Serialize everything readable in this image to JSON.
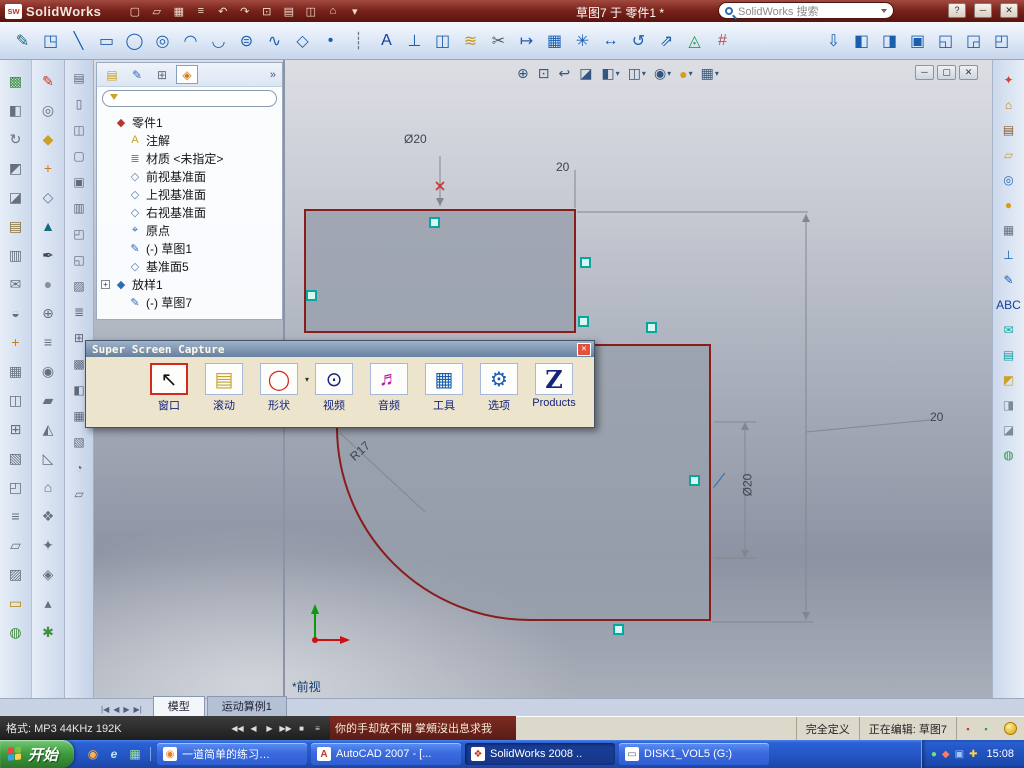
{
  "titlebar": {
    "logo_badge": "sw",
    "logo_text": "SolidWorks",
    "menu_icons": [
      {
        "glyph": "▢",
        "name": "new-document-icon"
      },
      {
        "glyph": "▱",
        "name": "open-icon"
      },
      {
        "glyph": "▦",
        "name": "save-icon"
      },
      {
        "glyph": "≡",
        "name": "print-icon"
      },
      {
        "glyph": "↶",
        "name": "undo-icon"
      },
      {
        "glyph": "↷",
        "name": "redo-icon"
      },
      {
        "glyph": "⊡",
        "name": "select-icon"
      },
      {
        "glyph": "▤",
        "name": "rebuild-icon"
      },
      {
        "glyph": "◫",
        "name": "options-icon"
      },
      {
        "glyph": "⌂",
        "name": "appearance-icon"
      },
      {
        "glyph": "▾",
        "name": "menu-expand-icon"
      }
    ],
    "doc_title": "草图7 于 零件1 *",
    "search": {
      "placeholder": "SolidWorks 搜索"
    },
    "window_buttons": [
      {
        "glyph": "?",
        "name": "help-button"
      },
      {
        "glyph": "─",
        "name": "minimize-button"
      },
      {
        "glyph": "✕",
        "name": "close-button"
      }
    ]
  },
  "main_toolbar": {
    "icons": [
      {
        "glyph": "✎",
        "color": "#17697d",
        "name": "sketch-tool-icon"
      },
      {
        "glyph": "◳",
        "color": "#1a5fae",
        "name": "3d-sketch-icon"
      },
      {
        "glyph": "╲",
        "color": "#1a5fae",
        "name": "line-tool-icon"
      },
      {
        "glyph": "▭",
        "color": "#1a5fae",
        "name": "rectangle-tool-icon"
      },
      {
        "glyph": "◯",
        "color": "#1a5fae",
        "name": "circle-tool-icon"
      },
      {
        "glyph": "◎",
        "color": "#1a5fae",
        "name": "perimeter-circle-icon"
      },
      {
        "glyph": "◠",
        "color": "#1a5fae",
        "name": "centerpoint-arc-icon"
      },
      {
        "glyph": "◡",
        "color": "#1a5fae",
        "name": "tangent-arc-icon"
      },
      {
        "glyph": "⊜",
        "color": "#1a5fae",
        "name": "ellipse-tool-icon"
      },
      {
        "glyph": "∿",
        "color": "#1a5fae",
        "name": "spline-tool-icon"
      },
      {
        "glyph": "◇",
        "color": "#1a5fae",
        "name": "polygon-tool-icon"
      },
      {
        "glyph": "•",
        "color": "#1a5fae",
        "name": "point-tool-icon"
      },
      {
        "glyph": "┊",
        "color": "#667788",
        "name": "centerline-tool-icon"
      },
      {
        "glyph": "A",
        "color": "#123f9e",
        "name": "text-tool-icon"
      },
      {
        "glyph": "⊥",
        "color": "#1a5fae",
        "name": "convert-entities-icon"
      },
      {
        "glyph": "◫",
        "color": "#1a5fae",
        "name": "mirror-entities-icon"
      },
      {
        "glyph": "≋",
        "color": "#c99312",
        "name": "offset-entities-icon"
      },
      {
        "glyph": "✂",
        "color": "#555555",
        "name": "trim-entities-icon"
      },
      {
        "glyph": "↦",
        "color": "#1a5fae",
        "name": "extend-entities-icon"
      },
      {
        "glyph": "▦",
        "color": "#1a5fae",
        "name": "linear-pattern-icon"
      },
      {
        "glyph": "✳",
        "color": "#1a5fae",
        "name": "circular-pattern-icon"
      },
      {
        "glyph": "↔",
        "color": "#1a5fae",
        "name": "move-entities-icon"
      },
      {
        "glyph": "↺",
        "color": "#1a5fae",
        "name": "rotate-entities-icon"
      },
      {
        "glyph": "⇗",
        "color": "#1a5fae",
        "name": "scale-entities-icon"
      },
      {
        "glyph": "◬",
        "color": "#2a9d4a",
        "name": "add-relation-icon"
      },
      {
        "glyph": "#",
        "color": "#bf4a4a",
        "name": "grid-icon"
      }
    ],
    "right_icons": [
      {
        "glyph": "⇩",
        "color": "#1a5fae",
        "name": "insert-icon"
      },
      {
        "glyph": "◧",
        "color": "#1a5fae",
        "name": "window-left-icon"
      },
      {
        "glyph": "◨",
        "color": "#1a5fae",
        "name": "window-right-icon"
      },
      {
        "glyph": "▣",
        "color": "#1a5fae",
        "name": "new-window-icon"
      },
      {
        "glyph": "◱",
        "color": "#1a5fae",
        "name": "tile-windows-icon"
      },
      {
        "glyph": "◲",
        "color": "#1a5fae",
        "name": "cascade-windows-icon"
      },
      {
        "glyph": "◰",
        "color": "#1a5fae",
        "name": "arrange-windows-icon"
      }
    ]
  },
  "left_toolbar_a": {
    "icons": [
      {
        "glyph": "▩",
        "color": "#3f8f3f"
      },
      {
        "glyph": "◧",
        "color": "#66707e"
      },
      {
        "glyph": "↻",
        "color": "#66707e"
      },
      {
        "glyph": "◩",
        "color": "#66707e"
      },
      {
        "glyph": "◪",
        "color": "#66707e"
      },
      {
        "glyph": "▤",
        "color": "#8a7340"
      },
      {
        "glyph": "▥",
        "color": "#66707e"
      },
      {
        "glyph": "✉",
        "color": "#66707e"
      },
      {
        "glyph": "◒",
        "color": "#66707e"
      },
      {
        "glyph": "+",
        "color": "#d07a1a"
      },
      {
        "glyph": "▦",
        "color": "#66707e"
      },
      {
        "glyph": "◫",
        "color": "#66707e"
      },
      {
        "glyph": "⊞",
        "color": "#66707e"
      },
      {
        "glyph": "▧",
        "color": "#66707e"
      },
      {
        "glyph": "◰",
        "color": "#66707e"
      },
      {
        "glyph": "≡",
        "color": "#66707e"
      },
      {
        "glyph": "▱",
        "color": "#66707e"
      },
      {
        "glyph": "▨",
        "color": "#66707e"
      },
      {
        "glyph": "▭",
        "color": "#b8860b"
      },
      {
        "glyph": "◍",
        "color": "#3f8f3f"
      }
    ]
  },
  "left_toolbar_b": {
    "icons": [
      {
        "glyph": "✎",
        "color": "#c0392b"
      },
      {
        "glyph": "◎",
        "color": "#66707e"
      },
      {
        "glyph": "◆",
        "color": "#c9a227"
      },
      {
        "glyph": "+",
        "color": "#d07a1a"
      },
      {
        "glyph": "◇",
        "color": "#5b7aa8"
      },
      {
        "glyph": "▲",
        "color": "#17697d"
      },
      {
        "glyph": "✒",
        "color": "#444444"
      },
      {
        "glyph": "●",
        "color": "#8a8f98"
      },
      {
        "glyph": "⊕",
        "color": "#66707e"
      },
      {
        "glyph": "≡",
        "color": "#66707e"
      },
      {
        "glyph": "◉",
        "color": "#66707e"
      },
      {
        "glyph": "▰",
        "color": "#66707e"
      },
      {
        "glyph": "◭",
        "color": "#66707e"
      },
      {
        "glyph": "◺",
        "color": "#66707e"
      },
      {
        "glyph": "⌂",
        "color": "#66707e"
      },
      {
        "glyph": "❖",
        "color": "#66707e"
      },
      {
        "glyph": "✦",
        "color": "#66707e"
      },
      {
        "glyph": "◈",
        "color": "#66707e"
      },
      {
        "glyph": "▴",
        "color": "#66707e"
      },
      {
        "glyph": "✱",
        "color": "#3f8f3f"
      }
    ]
  },
  "doc_strip": {
    "icons": [
      {
        "glyph": "▤"
      },
      {
        "glyph": "▯"
      },
      {
        "glyph": "◫"
      },
      {
        "glyph": "▢"
      },
      {
        "glyph": "▣"
      },
      {
        "glyph": "▥"
      },
      {
        "glyph": "◰"
      },
      {
        "glyph": "◱"
      },
      {
        "glyph": "▨"
      },
      {
        "glyph": "≣"
      },
      {
        "glyph": "⊞"
      },
      {
        "glyph": "▩"
      },
      {
        "glyph": "◧"
      },
      {
        "glyph": "▦"
      },
      {
        "glyph": "▧"
      },
      {
        "glyph": "◔"
      },
      {
        "glyph": "▱"
      }
    ]
  },
  "right_panel": {
    "icons": [
      {
        "glyph": "✦",
        "color": "#d24726",
        "name": "resources-icon"
      },
      {
        "glyph": "⌂",
        "color": "#b8860b",
        "name": "home-icon"
      },
      {
        "glyph": "▤",
        "color": "#8a5a2b",
        "name": "design-library-icon"
      },
      {
        "glyph": "▱",
        "color": "#c9a227",
        "name": "file-explorer-icon"
      },
      {
        "glyph": "◎",
        "color": "#2a6db5",
        "name": "search-pane-icon"
      },
      {
        "glyph": "●",
        "color": "#d4a017",
        "name": "appearances-icon"
      },
      {
        "glyph": "▦",
        "color": "#66707e",
        "name": "view-palette-icon"
      },
      {
        "glyph": "⊥",
        "color": "#1a5fae",
        "name": "normal-to-icon"
      },
      {
        "glyph": "✎",
        "color": "#1a5fae",
        "name": "sketch-icon"
      },
      {
        "glyph": "ABC",
        "color": "#123f9e",
        "name": "spellcheck-icon"
      },
      {
        "glyph": "✉",
        "color": "#18a0a0",
        "name": "note-icon"
      },
      {
        "glyph": "▤",
        "color": "#18a0a0",
        "name": "table-icon"
      },
      {
        "glyph": "◩",
        "color": "#c9a227",
        "name": "section-icon"
      },
      {
        "glyph": "◨",
        "color": "#7a8a99",
        "name": "display-style-icon"
      },
      {
        "glyph": "◪",
        "color": "#7a8a99",
        "name": "shaded-icon"
      },
      {
        "glyph": "◍",
        "color": "#2a9d4a",
        "name": "measure-icon"
      }
    ]
  },
  "feature_panel": {
    "tabs": [
      {
        "glyph": "▤",
        "color": "#c9a227",
        "name": "featuremanager-tab"
      },
      {
        "glyph": "✎",
        "color": "#2a6db5",
        "name": "propertymanager-tab"
      },
      {
        "glyph": "⊞",
        "color": "#66707e",
        "name": "configurationmanager-tab"
      },
      {
        "glyph": "◈",
        "color": "#d07a1a",
        "active": true,
        "name": "dimxpert-tab"
      }
    ],
    "chevron": "»",
    "tree": [
      {
        "prefix": "",
        "icon": "◆",
        "color": "#b03a2e",
        "label": "零件1",
        "pad": 2,
        "name": "tree-item-part1"
      },
      {
        "prefix": "",
        "icon": "A",
        "color": "#c9a227",
        "label": "注解",
        "pad": 16,
        "name": "tree-item-annotations"
      },
      {
        "prefix": "",
        "icon": "≣",
        "color": "#8a6d3b",
        "label": "材质 <未指定>",
        "pad": 16,
        "name": "tree-item-material"
      },
      {
        "prefix": "",
        "icon": "◇",
        "color": "#5b7aa8",
        "label": "前视基准面",
        "pad": 16,
        "name": "tree-item-front-plane"
      },
      {
        "prefix": "",
        "icon": "◇",
        "color": "#5b7aa8",
        "label": "上视基准面",
        "pad": 16,
        "name": "tree-item-top-plane"
      },
      {
        "prefix": "",
        "icon": "◇",
        "color": "#5b7aa8",
        "label": "右视基准面",
        "pad": 16,
        "name": "tree-item-right-plane"
      },
      {
        "prefix": "",
        "icon": "⌖",
        "color": "#2a6db5",
        "label": "原点",
        "pad": 16,
        "name": "tree-item-origin"
      },
      {
        "prefix": "",
        "icon": "✎",
        "color": "#2a6db5",
        "label": "(-) 草图1",
        "pad": 16,
        "name": "tree-item-sketch1"
      },
      {
        "prefix": "",
        "icon": "◇",
        "color": "#5b7aa8",
        "label": "基准面5",
        "pad": 16,
        "name": "tree-item-plane5"
      },
      {
        "prefix": "+",
        "icon": "◆",
        "color": "#2a6db5",
        "label": "放样1",
        "pad": 2,
        "name": "tree-item-loft1"
      },
      {
        "prefix": "",
        "icon": "✎",
        "color": "#2a6db5",
        "label": "(-) 草图7",
        "pad": 16,
        "name": "tree-item-sketch7"
      }
    ]
  },
  "viewport": {
    "heads_up": [
      {
        "glyph": "⊕",
        "caret": "",
        "name": "zoom-fit-icon"
      },
      {
        "glyph": "⊡",
        "caret": "",
        "name": "zoom-area-icon"
      },
      {
        "glyph": "↩",
        "caret": "",
        "name": "previous-view-icon"
      },
      {
        "glyph": "◪",
        "caret": "",
        "name": "section-view-icon"
      },
      {
        "glyph": "◧",
        "caret": "▾",
        "name": "view-orientation-icon"
      },
      {
        "glyph": "◫",
        "caret": "▾",
        "name": "display-style-icon"
      },
      {
        "glyph": "◉",
        "caret": "▾",
        "name": "hide-show-icon"
      },
      {
        "glyph": "●",
        "color": "#d4a017",
        "caret": "▾",
        "name": "appearance-icon"
      },
      {
        "glyph": "▦",
        "caret": "▾",
        "name": "scene-icon"
      }
    ],
    "window_buttons": [
      {
        "glyph": "─",
        "name": "minimize-document-button"
      },
      {
        "glyph": "▢",
        "name": "restore-document-button"
      },
      {
        "glyph": "✕",
        "name": "close-document-button"
      }
    ],
    "dims": {
      "top_diameter": "Ø20",
      "top_width": "20",
      "right_height": "20",
      "right_diameter": "Ø20",
      "radius": "R17"
    },
    "view_label": "*前视"
  },
  "capture_dialog": {
    "title": "Super Screen Capture",
    "close_glyph": "✕",
    "buttons": [
      {
        "label": "窗口",
        "glyph": "↖",
        "color": "#111111",
        "caret": "",
        "name": "capture-window-button"
      },
      {
        "label": "滚动",
        "glyph": "▤",
        "color": "#c9a227",
        "caret": "",
        "name": "capture-scroll-button"
      },
      {
        "label": "形状",
        "glyph": "◯",
        "color": "#d42a1e",
        "caret": "▾",
        "name": "capture-shape-button"
      },
      {
        "label": "视频",
        "glyph": "⊙",
        "color": "#15247a",
        "caret": "",
        "name": "capture-video-button"
      },
      {
        "label": "音频",
        "glyph": "♬",
        "color": "#b5179e",
        "caret": "",
        "name": "capture-audio-button"
      },
      {
        "label": "工具",
        "glyph": "▦",
        "color": "#1a5fae",
        "caret": "",
        "name": "capture-tools-button"
      },
      {
        "label": "选项",
        "glyph": "⚙",
        "color": "#1a5fae",
        "caret": "",
        "name": "capture-options-button"
      },
      {
        "label": "Products",
        "glyph": "Z",
        "color": "#15247a",
        "caret": "",
        "name": "capture-products-button"
      }
    ]
  },
  "bottom_tabs": {
    "nav": [
      {
        "glyph": "|◀",
        "name": "first-tab-arrow"
      },
      {
        "glyph": "◀",
        "name": "prev-tab-arrow"
      },
      {
        "glyph": "▶",
        "name": "next-tab-arrow"
      },
      {
        "glyph": "▶|",
        "name": "last-tab-arrow"
      }
    ],
    "tabs": [
      {
        "label": "模型",
        "active": true,
        "name": "tab-model"
      },
      {
        "label": "运动算例1",
        "name": "tab-motion-study1"
      }
    ]
  },
  "statusbar": {
    "format_label": "格式: MP3 44KHz 192K",
    "media_controls": [
      {
        "glyph": "◀◀",
        "name": "rewind-icon"
      },
      {
        "glyph": "◀",
        "name": "previous-icon"
      },
      {
        "glyph": "▶",
        "name": "play-icon"
      },
      {
        "glyph": "▶▶",
        "name": "forward-icon"
      },
      {
        "glyph": "■",
        "name": "stop-icon"
      },
      {
        "glyph": "≡",
        "name": "playlist-icon"
      }
    ],
    "lyric": "你的手却放不開 掌頰沒出息求我",
    "define_state": "完全定义",
    "editing_state": "正在编辑: 草图7",
    "icons": [
      {
        "glyph": "▪",
        "color": "#c0392b",
        "name": "status-red-icon"
      },
      {
        "glyph": "▪",
        "color": "#2a9d4a",
        "name": "status-green-icon"
      }
    ]
  },
  "taskbar": {
    "start_label": "开始",
    "quick_launch": [
      {
        "glyph": "◉",
        "color": "#ffb347",
        "name": "media-player-icon"
      },
      {
        "glyph": "e",
        "color": "#bfe0ff",
        "name": "internet-explorer-icon"
      },
      {
        "glyph": "▦",
        "color": "#9fe29f",
        "name": "show-desktop-icon"
      }
    ],
    "tasks": [
      {
        "icon": "◉",
        "color": "#e67e22",
        "label": "一道简单的练习…",
        "name": "taskbar-item-exercise"
      },
      {
        "icon": "A",
        "color": "#c0392b",
        "label": "AutoCAD 2007 - [...",
        "name": "taskbar-item-autocad"
      },
      {
        "icon": "❖",
        "color": "#c0392b",
        "label": "SolidWorks 2008 ..",
        "active": true,
        "name": "taskbar-item-solidworks"
      },
      {
        "icon": "▭",
        "color": "#5c6a7a",
        "label": "DISK1_VOL5 (G:)",
        "name": "taskbar-item-disk"
      }
    ],
    "tray_icons": [
      {
        "glyph": "●",
        "color": "#7ae07a",
        "name": "tray-green-icon"
      },
      {
        "glyph": "◆",
        "color": "#ff7a6a",
        "name": "tray-red-icon"
      },
      {
        "glyph": "▣",
        "color": "#9fc6ff",
        "name": "tray-blue-icon"
      },
      {
        "glyph": "✚",
        "color": "#ffd24c",
        "name": "tray-yellow-icon"
      }
    ],
    "clock": "15:08"
  }
}
